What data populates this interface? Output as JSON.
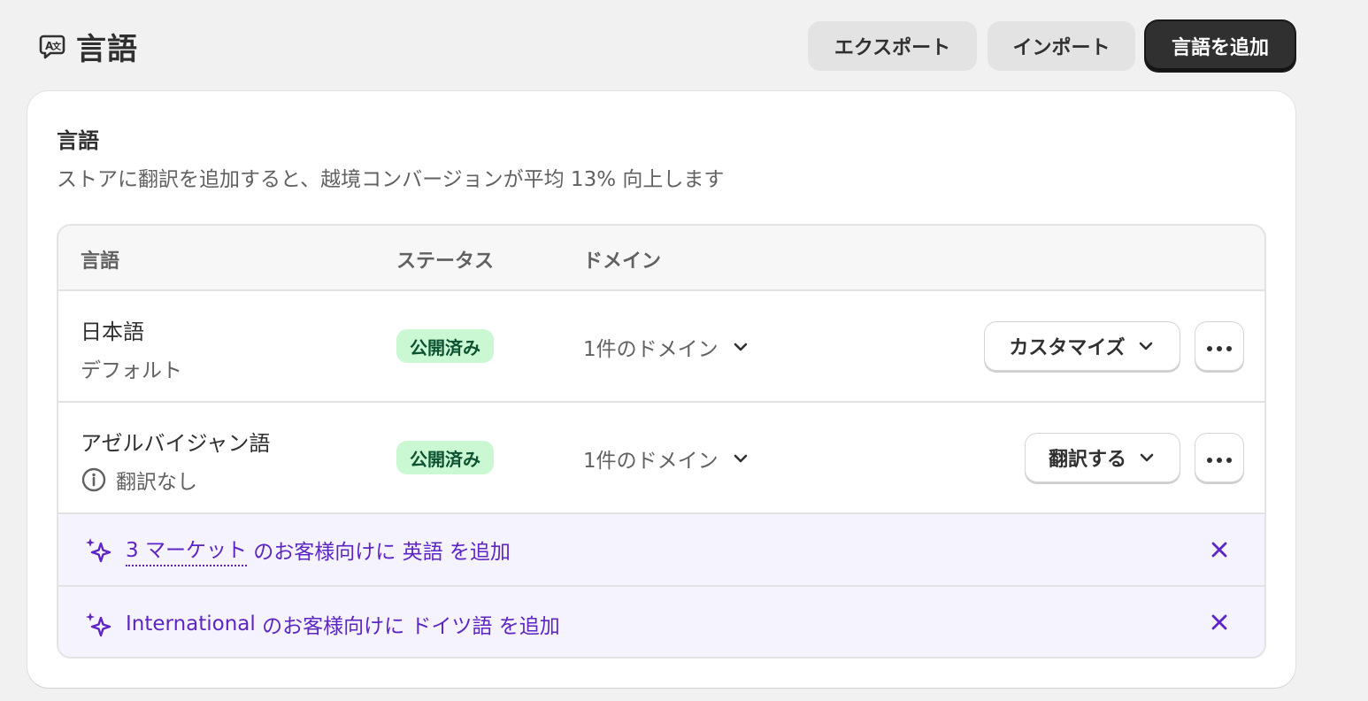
{
  "header": {
    "title": "言語",
    "icon": "translate-icon",
    "export_label": "エクスポート",
    "import_label": "インポート",
    "add_language_label": "言語を追加"
  },
  "card": {
    "title": "言語",
    "description": "ストアに翻訳を追加すると、越境コンバージョンが平均 13% 向上します"
  },
  "table": {
    "columns": [
      "言語",
      "ステータス",
      "ドメイン"
    ],
    "rows": [
      {
        "name": "日本語",
        "subtext": "デフォルト",
        "status": "公開済み",
        "domain": "1件のドメイン",
        "action_label": "カスタマイズ"
      },
      {
        "name": "アゼルバイジャン語",
        "subtext": "翻訳なし",
        "status": "公開済み",
        "domain": "1件のドメイン",
        "action_label": "翻訳する"
      }
    ]
  },
  "suggestions": [
    {
      "link": "3 マーケット",
      "text1": " のお客様向けに ",
      "language": "英語",
      "text2": " を追加"
    },
    {
      "link": "International",
      "text1": " のお客様向けに ",
      "language": "ドイツ語",
      "text2": " を追加"
    }
  ],
  "colors": {
    "primary_button": "#303030",
    "badge_bg": "#c9f8d2",
    "badge_text": "#0c5132",
    "suggestion_bg": "#f5f3fe",
    "suggestion_text": "#5c25c4"
  }
}
